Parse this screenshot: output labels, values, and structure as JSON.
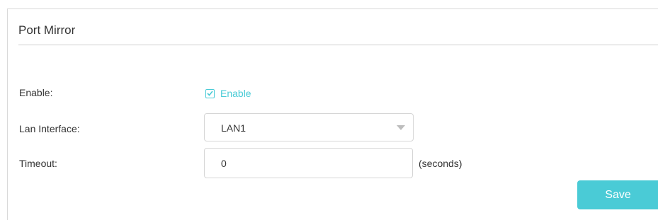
{
  "section": {
    "title": "Port Mirror"
  },
  "enable": {
    "label": "Enable:",
    "checkbox_label": "Enable",
    "checked": true
  },
  "lan_interface": {
    "label": "Lan Interface:",
    "selected": "LAN1"
  },
  "timeout": {
    "label": "Timeout:",
    "value": "0",
    "unit": "(seconds)"
  },
  "actions": {
    "save_label": "Save"
  },
  "colors": {
    "accent": "#4acbd6",
    "border": "#d6d6d6",
    "text": "#333333"
  },
  "icons": {
    "checkbox": "checkbox-checked-icon",
    "dropdown": "chevron-down-icon"
  }
}
